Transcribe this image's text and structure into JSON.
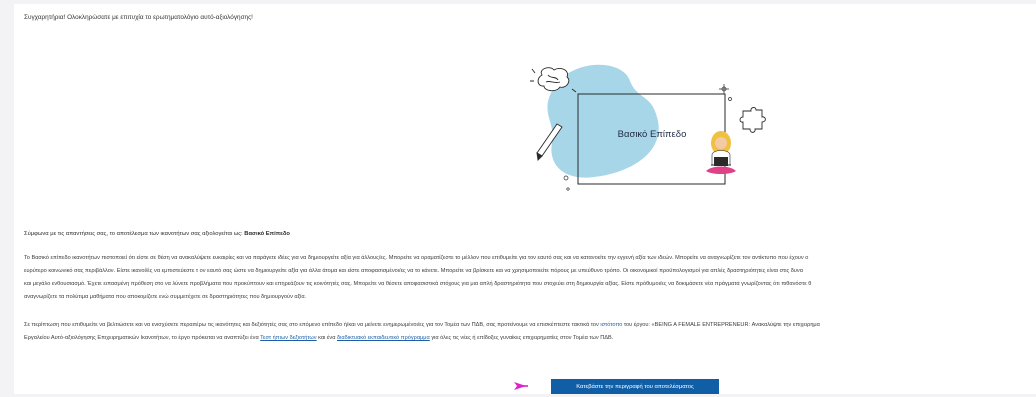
{
  "congrats_text": "Συγχαρητήρια! Ολοκληρώσατε με επιτυχία το ερωτηματολόγιο αυτό-αξιολόγησης!",
  "illustration_label": "Βασικό Επίπεδο",
  "result": {
    "prefix": "Σύμφωνα με τις απαντήσεις σας, το αποτέλεσμα των ικανοτήτων σας αξιολογείται ως: ",
    "level": "Βασικό Επίπεδο"
  },
  "paragraph1": [
    "Το Βασικό επίπεδο ικανοτήτων πιστοποιεί ότι είστε σε θέση να ανακαλύψετε ευκαιρίες και να παράγετε ιδέες για να δημιουργείτε αξία για άλλους/ες. Μπορείτε να οραματίζεστε το μέλλον που επιθυμείτε για τον εαυτό σας και να κατανοείτε την εγγενή αξία των ιδεών. Μπορείτε να αναγνωρίζετε τον αντίκτυπο που έχουν ο",
    "ευρύτερο κοινωνικό σας περιβάλλον. Είστε ικανοί/ές να εμπιστεύεστε τ ον εαυτό σας ώστε να δημιουργείτε αξία για άλλα άτομα και είστε αποφασισμένοι/ες να το κάνετε. Μπορείτε να βρίσκετε και να χρησιμοποιείτε πόρους με υπεύθυνο τρόπο. Οι οικονομικοί προϋπολογισμοί για απλές δραστηριότητες είναι στις δυνα",
    "και μεγάλο ενθουσιασμό. Έχετε ειπασμένη πρόθεση στο να λύνετε προβλήματα που προκύπτουν και επηρεάζουν τις κοινότητές σας. Μπορείτε να θέσετε αποφασιστικά στόχους για μια απλή δραστηριότητα που στοχεύει στη δημιουργία αξίας. Είστε πρόθυμοι/ες να δοκιμάσετε νέα πράγματα γνωρίζοντας ότι πιθανόστε θ",
    "αναγνωρίζετε τα πολύτιμα μαθήματα που αποκομίζετε ενώ συμμετέχετε σε δραστηριότητες που δημιουργούν αξία."
  ],
  "paragraph2": {
    "l1_before": "Σε περίπτωση που επιθυμείτε να βελτιώσετε και να ενισχύσετε περαιτέρω τις ικανότητες και δεξιότητές σας στο επόμενο επίπεδο ή/και να μείνετε ενημερωμένοι/ες για τον Τομέα των ΠΔΒ, σας προτείνουμε να επισκέπτεστε τακτικά τον ",
    "link_site": "ιστότοπο",
    "l1_after": " του έργου: «BEING A FEMALE ENTREPRENEUR: Ανακαλύψτε την επιχειρημα",
    "l2_before": "Εργαλείου Αυτό-αξιολόγησης Επιχειρηματικών Ικανοτήτων, το έργο πρόκειται να αναπτύξει ένα ",
    "link_test": "Τεστ ήπιων δεξιοτήτων",
    "l2_mid": " και ένα ",
    "link_program": "διαδικτυακό εκπαιδευτικό πρόγραμμα",
    "l2_after": " για όλες τις νέες ή επίδοξες γυναίκες επιχειρηματίες στον Τομέα των ΠΔΒ."
  },
  "cta_label": "Κατεβάστε την περιγραφή του αποτελέσματος",
  "colors": {
    "accent_blue": "#0f5ea6",
    "blob": "#a7d6e8",
    "pointer": "#e020c8"
  },
  "icons": [
    "brain-icon",
    "pencil-icon",
    "puzzle-icon",
    "woman-laptop-icon",
    "pointer-arrow-icon",
    "sparkle-icon"
  ]
}
